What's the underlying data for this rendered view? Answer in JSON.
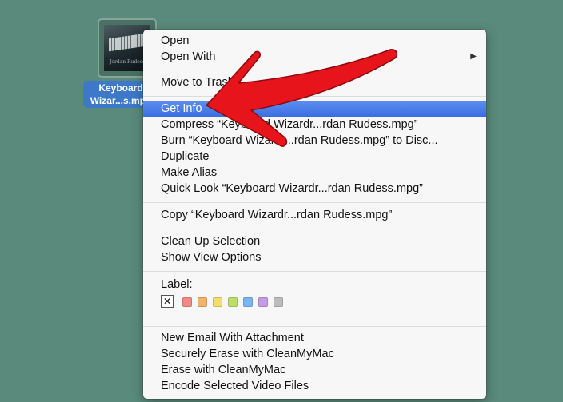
{
  "desktop_file": {
    "label_line1": "Keyboard",
    "label_line2": "Wizar...s.mpg",
    "thumb_text": "Jordan Rudess"
  },
  "menu": {
    "items": [
      {
        "label": "Open"
      },
      {
        "label": "Open With",
        "submenu": true
      },
      {
        "label": "Move to Trash"
      },
      {
        "label": "Get Info",
        "selected": true
      },
      {
        "label": "Compress “Keyboard Wizardr...rdan Rudess.mpg”"
      },
      {
        "label": "Burn “Keyboard Wizardr...rdan Rudess.mpg” to Disc..."
      },
      {
        "label": "Duplicate"
      },
      {
        "label": "Make Alias"
      },
      {
        "label": "Quick Look “Keyboard Wizardr...rdan Rudess.mpg”"
      },
      {
        "label": "Copy “Keyboard Wizardr...rdan Rudess.mpg”"
      },
      {
        "label": "Clean Up Selection"
      },
      {
        "label": "Show View Options"
      },
      {
        "label": "New Email With Attachment"
      },
      {
        "label": "Securely Erase with CleanMyMac"
      },
      {
        "label": "Erase with CleanMyMac"
      },
      {
        "label": "Encode Selected Video Files"
      }
    ],
    "submenu_arrow": "▶",
    "label_section": {
      "title": "Label:",
      "none_symbol": "✕",
      "colors": [
        "#f08a84",
        "#f3b36b",
        "#f1df6a",
        "#bcdf6a",
        "#79b6f2",
        "#c69be6",
        "#bdbdbd"
      ]
    }
  },
  "overlay": {
    "arrow_color": "#e8141c"
  }
}
